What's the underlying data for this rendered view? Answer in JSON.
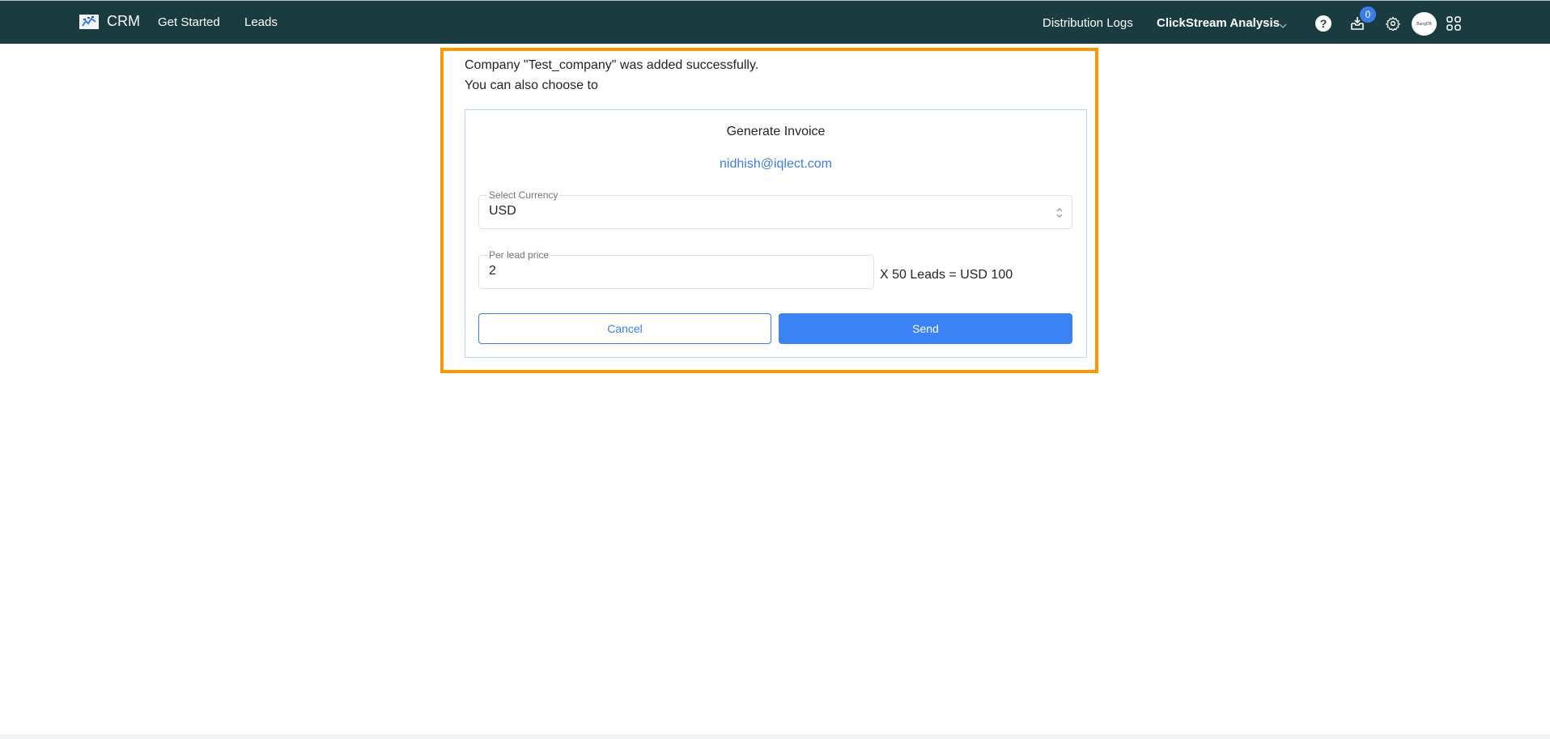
{
  "header": {
    "brand": "CRM",
    "nav": [
      "Get Started",
      "Leads"
    ],
    "right_links": {
      "distribution_logs": "Distribution Logs",
      "workspace": "ClickStream Analysis"
    },
    "notification_count": "0",
    "avatar_text": "BangDB",
    "icons": {
      "help": "question-circle-icon",
      "inbox": "inbox-download-icon",
      "settings": "gear-icon",
      "apps": "grid-apps-icon",
      "chevron": "chevron-down-icon"
    },
    "colors": {
      "background": "#1a3c40",
      "badge": "#3b7de9"
    }
  },
  "main": {
    "success_message": "Company \"Test_company\" was added successfully.",
    "sub_message": "You can also choose to",
    "highlight_color": "#ff9800",
    "invoice": {
      "title": "Generate Invoice",
      "email": "nidhish@iqlect.com",
      "currency_field": {
        "label": "Select Currency",
        "value": "USD"
      },
      "price_field": {
        "label": "Per lead price",
        "value": "2"
      },
      "calculation": "X 50 Leads = USD 100",
      "cancel_label": "Cancel",
      "send_label": "Send",
      "accent_color": "#3b82f6"
    }
  }
}
